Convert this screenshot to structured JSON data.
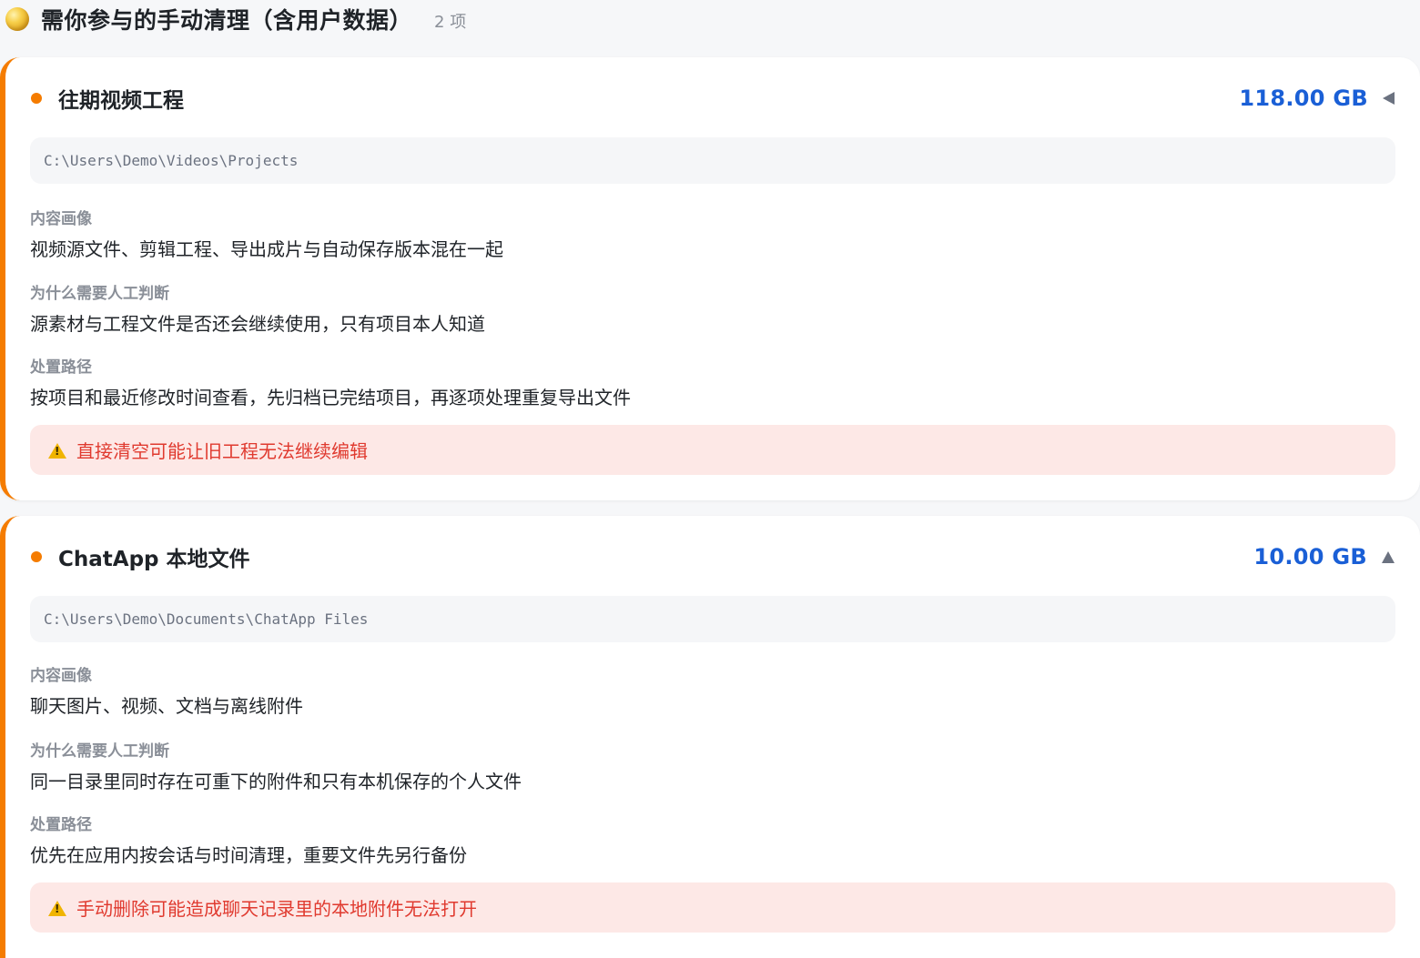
{
  "section": {
    "title": "需你参与的手动清理（含用户数据）",
    "count": "2 项",
    "icon": "coin-icon"
  },
  "colors": {
    "accent": "#f57c00",
    "size": "#1a5fd6",
    "warning_text": "#e03a2f",
    "warning_bg": "#fde8e6"
  },
  "cards": [
    {
      "title": "往期视频工程",
      "size": "118.00 GB",
      "toggle": "collapse-left",
      "path": "C:\\Users\\Demo\\Videos\\Projects",
      "profile_label": "内容画像",
      "profile": "视频源文件、剪辑工程、导出成片与自动保存版本混在一起",
      "why_label": "为什么需要人工判断",
      "why": "源素材与工程文件是否还会继续使用，只有项目本人知道",
      "action_label": "处置路径",
      "action": "按项目和最近修改时间查看，先归档已完结项目，再逐项处理重复导出文件",
      "warning": "直接清空可能让旧工程无法继续编辑"
    },
    {
      "title": "ChatApp 本地文件",
      "size": "10.00 GB",
      "toggle": "collapse-up",
      "path": "C:\\Users\\Demo\\Documents\\ChatApp Files",
      "profile_label": "内容画像",
      "profile": "聊天图片、视频、文档与离线附件",
      "why_label": "为什么需要人工判断",
      "why": "同一目录里同时存在可重下的附件和只有本机保存的个人文件",
      "action_label": "处置路径",
      "action": "优先在应用内按会话与时间清理，重要文件先另行备份",
      "warning": "手动删除可能造成聊天记录里的本地附件无法打开"
    }
  ]
}
